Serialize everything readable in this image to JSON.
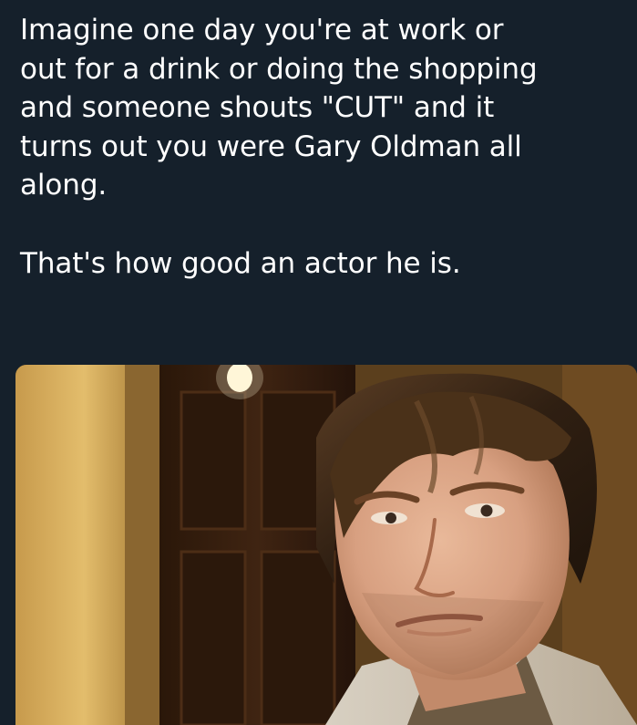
{
  "post": {
    "paragraph_1": "Imagine one day you're at work or\nout for a drink or doing the shopping\nand someone shouts \"CUT\" and it\nturns out you were Gary Oldman all\nalong.",
    "paragraph_2": "That's how good an actor he is."
  },
  "photo": {
    "subject": "movie still of a man in a hallway looking at the camera"
  },
  "colors": {
    "background": "#15202b",
    "text": "#ffffff"
  }
}
